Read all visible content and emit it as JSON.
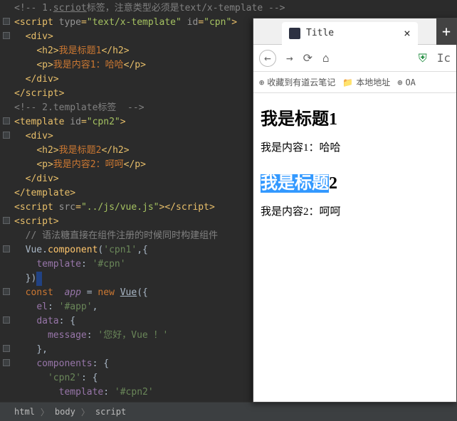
{
  "code": {
    "c1": "<!-- 1.scriot标签，注意类型必须是text/x-template -->",
    "l2_script": "script",
    "l2_type_a": "type",
    "l2_type_v": "\"text/x-template\"",
    "l2_id_a": "id",
    "l2_id_v": "\"cpn\"",
    "div": "div",
    "div_c": "/div",
    "h2": "h2",
    "h2_c": "/h2",
    "p": "p",
    "p_c": "/p",
    "t_h2_1": "我是标题1",
    "t_p_1": "我是内容1：哈哈",
    "script_c": "/script",
    "c2": "<!-- 2.template标签  -->",
    "template": "template",
    "template_c": "/template",
    "id_a": "id",
    "cpn2_v": "\"cpn2\"",
    "t_h2_2": "我是标题2",
    "t_p_2": "我是内容2：呵呵",
    "src_a": "src",
    "src_v": "\"../js/vue.js\"",
    "jscomment": "// 语法糖直接在组件注册的时候同时构建组件",
    "vue": "Vue",
    "component": "component",
    "cpn1s": "'cpn1'",
    "template_prop": "template",
    "cpn_hash": "'#cpn'",
    "const": "const",
    "app": "app",
    "new": "new",
    "VueC": "Vue",
    "el": "el",
    "appv": "'#app'",
    "data": "data",
    "message": "message",
    "msgv": "'您好，Vue ！'",
    "components": "components",
    "cpn2s": "'cpn2'",
    "cpn2hash": "'#cpn2'"
  },
  "breadcrumb": {
    "a": "html",
    "b": "body",
    "c": "script"
  },
  "browser": {
    "title": "Title",
    "bookmarks": {
      "a": "收藏到有道云笔记",
      "b": "本地地址",
      "c": "OA",
      "d": "Ic"
    },
    "h2_1": "我是标题1",
    "p_1": "我是内容1：哈哈",
    "h2_2a": "我是标题",
    "h2_2b": "2",
    "p_2": "我是内容2：呵呵"
  }
}
